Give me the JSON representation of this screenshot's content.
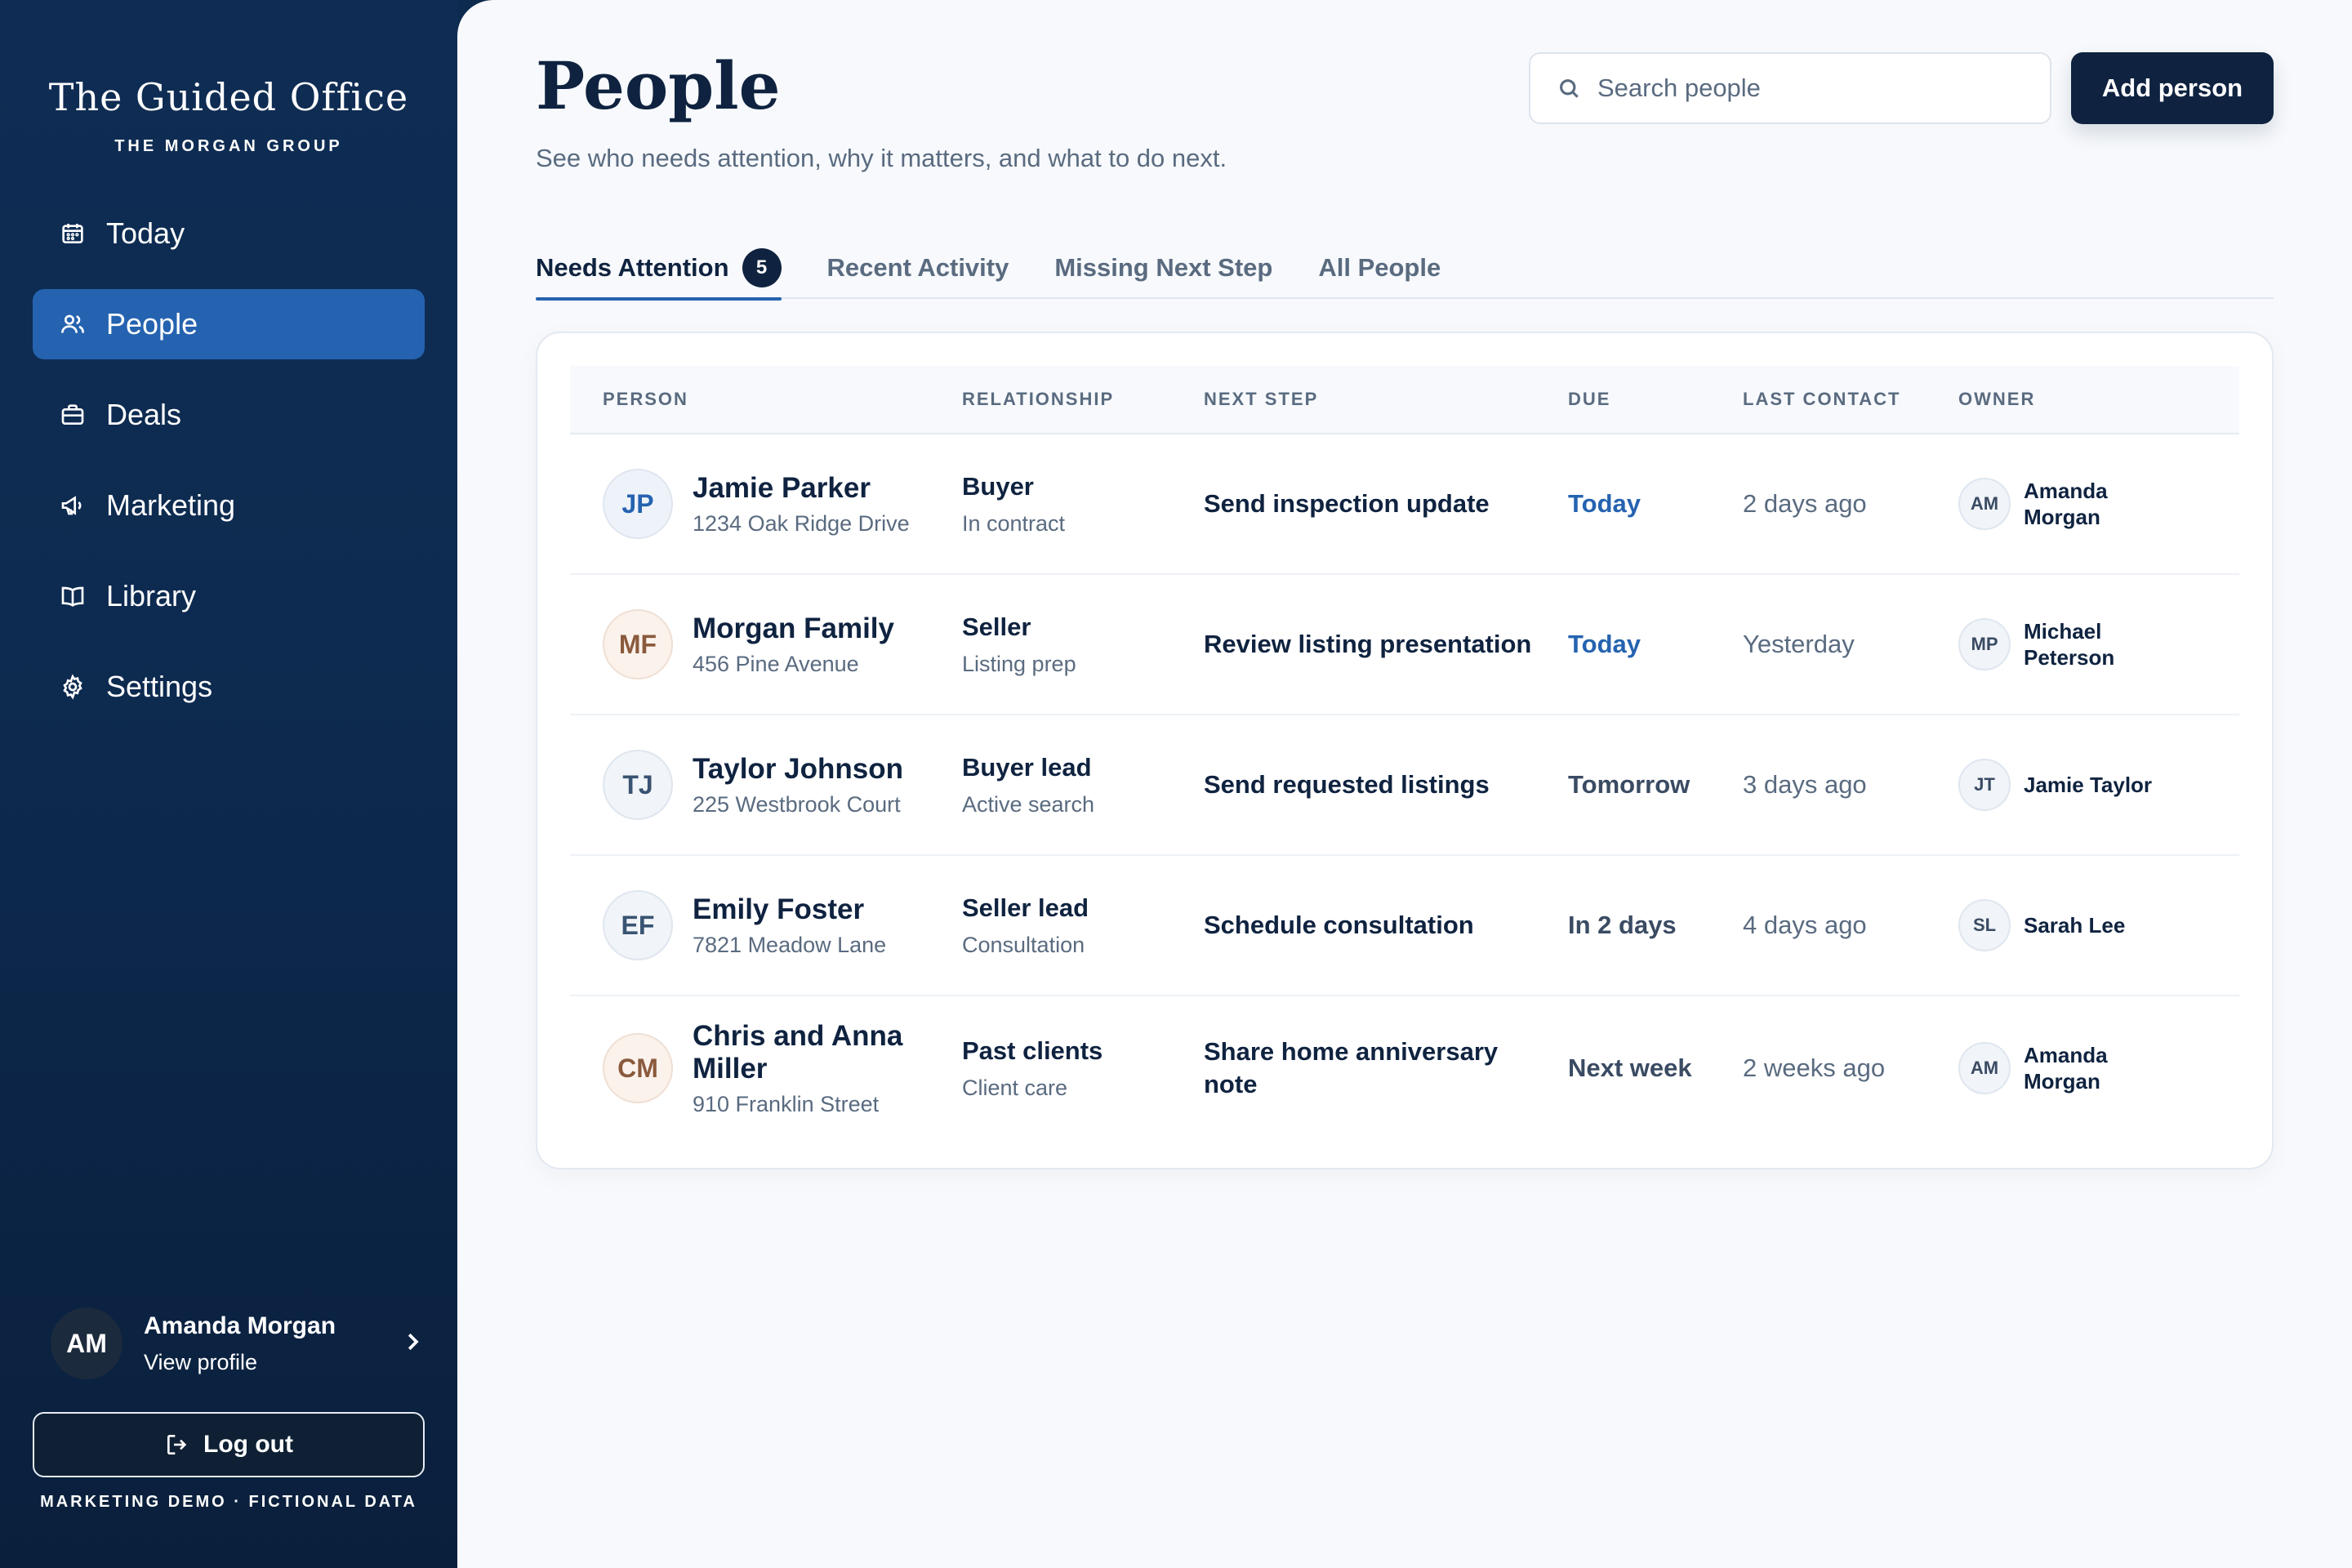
{
  "sidebar": {
    "brand_name": "The Guided Office",
    "brand_sub": "THE MORGAN GROUP",
    "nav": [
      {
        "label": "Today",
        "icon": "calendar-icon"
      },
      {
        "label": "People",
        "icon": "users-icon",
        "active": true
      },
      {
        "label": "Deals",
        "icon": "briefcase-icon"
      },
      {
        "label": "Marketing",
        "icon": "megaphone-icon"
      },
      {
        "label": "Library",
        "icon": "book-icon"
      },
      {
        "label": "Settings",
        "icon": "gear-icon"
      }
    ],
    "profile": {
      "initials": "AM",
      "name": "Amanda Morgan",
      "link": "View profile"
    },
    "logout_label": "Log out",
    "footer_note": "MARKETING DEMO · FICTIONAL DATA"
  },
  "header": {
    "title": "People",
    "subtitle": "See who needs attention, why it matters, and what to do next.",
    "search_placeholder": "Search people",
    "add_label": "Add person"
  },
  "tabs": [
    {
      "label": "Needs Attention",
      "badge": "5",
      "active": true
    },
    {
      "label": "Recent Activity"
    },
    {
      "label": "Missing Next Step"
    },
    {
      "label": "All People"
    }
  ],
  "table": {
    "columns": [
      "PERSON",
      "RELATIONSHIP",
      "NEXT STEP",
      "DUE",
      "LAST CONTACT",
      "OWNER"
    ],
    "rows": [
      {
        "initials": "JP",
        "name": "Jamie Parker",
        "address": "1234 Oak Ridge Drive",
        "relationship": "Buyer",
        "stage": "In contract",
        "next_step": "Send inspection update",
        "due": "Today",
        "last_contact": "2 days ago",
        "owner_initials": "AM",
        "owner": "Amanda Morgan"
      },
      {
        "initials": "MF",
        "name": "Morgan Family",
        "address": "456 Pine Avenue",
        "relationship": "Seller",
        "stage": "Listing prep",
        "next_step": "Review listing presentation",
        "due": "Today",
        "last_contact": "Yesterday",
        "owner_initials": "MP",
        "owner": "Michael Peterson"
      },
      {
        "initials": "TJ",
        "name": "Taylor Johnson",
        "address": "225 Westbrook Court",
        "relationship": "Buyer lead",
        "stage": "Active search",
        "next_step": "Send requested listings",
        "due": "Tomorrow",
        "last_contact": "3 days ago",
        "owner_initials": "JT",
        "owner": "Jamie Taylor"
      },
      {
        "initials": "EF",
        "name": "Emily Foster",
        "address": "7821 Meadow Lane",
        "relationship": "Seller lead",
        "stage": "Consultation",
        "next_step": "Schedule consultation",
        "due": "In 2 days",
        "last_contact": "4 days ago",
        "owner_initials": "SL",
        "owner": "Sarah Lee"
      },
      {
        "initials": "CM",
        "name": "Chris and Anna Miller",
        "address": "910 Franklin Street",
        "relationship": "Past clients",
        "stage": "Client care",
        "next_step": "Share home anniversary note",
        "due": "Next week",
        "last_contact": "2 weeks ago",
        "owner_initials": "AM",
        "owner": "Amanda Morgan"
      }
    ]
  },
  "colors": {
    "sidebar": "#0d2a4f",
    "accent": "#2563b0",
    "primary": "#0f2340"
  }
}
